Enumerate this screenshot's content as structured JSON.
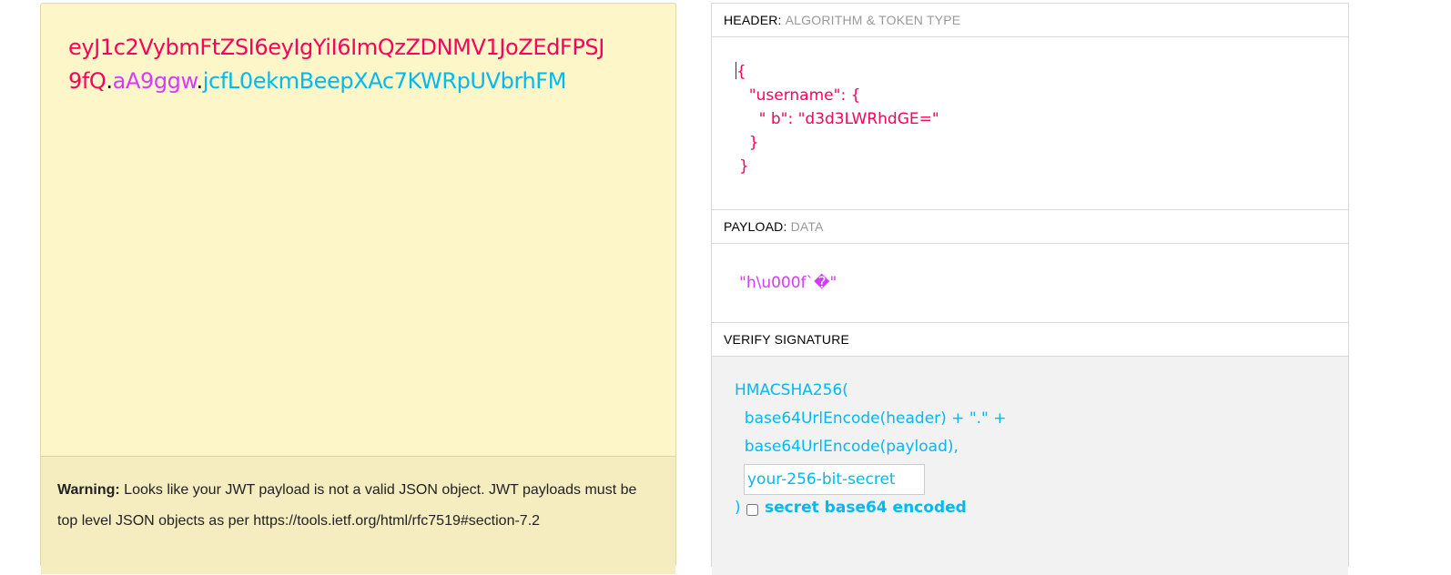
{
  "encoded": {
    "header_part": "eyJ1c2VybmFtZSI6eyIgYiI6ImQzZDNMV1JoZEdFPSJ9fQ",
    "dot1": ".",
    "payload_part": "aA9ggw",
    "dot2": ".",
    "signature_part": "jcfL0ekmBeepXAc7KWRpUVbrhFM"
  },
  "warning": {
    "bold": "Warning:",
    "text": " Looks like your JWT payload is not a valid JSON object. JWT payloads must be top level JSON objects as per https://tools.ietf.org/html/rfc7519#section-7.2"
  },
  "header_section": {
    "title": "HEADER:",
    "subtitle": "ALGORITHM & TOKEN TYPE",
    "json_lines": [
      "{",
      "  \"username\": {",
      "    \" b\": \"d3d3LWRhdGE=\"",
      "  }",
      "}"
    ]
  },
  "payload_section": {
    "title": "PAYLOAD:",
    "subtitle": "DATA",
    "json": "\"h\\u000f`�\""
  },
  "signature_section": {
    "title": "VERIFY SIGNATURE",
    "func": "HMACSHA256(",
    "line1": "  base64UrlEncode(header) + \".\" +",
    "line2": "  base64UrlEncode(payload),",
    "secret_placeholder": "your-256-bit-secret",
    "close": ")",
    "checkbox_label": "secret base64 encoded"
  },
  "colors": {
    "header": "#fb015b",
    "payload": "#d63aff",
    "signature": "#00b9f1",
    "panel_bg": "#fdf6c9"
  }
}
